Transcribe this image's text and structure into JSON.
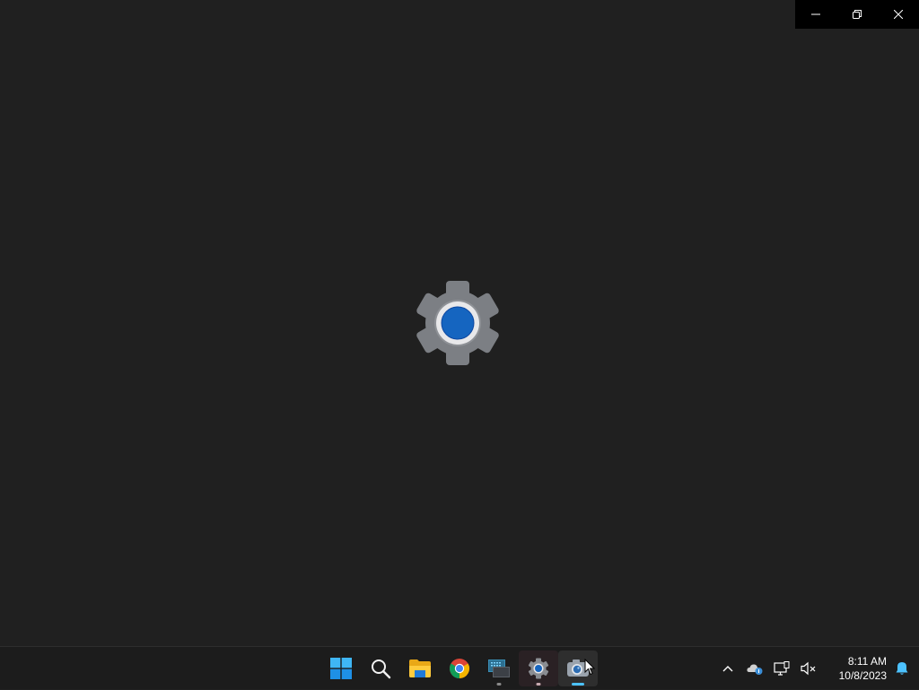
{
  "window": {
    "controls": {
      "minimize_icon": "minimize-icon",
      "restore_icon": "restore-icon",
      "close_icon": "close-icon"
    },
    "splash_icon": "settings-gear-icon"
  },
  "taskbar": {
    "apps": [
      {
        "name": "start",
        "icon": "windows-logo-icon"
      },
      {
        "name": "search",
        "icon": "search-icon"
      },
      {
        "name": "file-explorer",
        "icon": "folder-icon"
      },
      {
        "name": "chrome",
        "icon": "chrome-icon"
      },
      {
        "name": "terminal",
        "icon": "terminal-icon",
        "running": true
      },
      {
        "name": "settings",
        "icon": "settings-gear-icon",
        "running": true
      },
      {
        "name": "camera",
        "icon": "camera-icon",
        "running": true,
        "active": true
      }
    ],
    "tray": {
      "icons": [
        "chevron-up-icon",
        "onedrive-icon",
        "network-icon",
        "volume-muted-icon"
      ],
      "time": "8:11 AM",
      "date": "10/8/2023",
      "notification_icon": "bell-icon"
    }
  },
  "colors": {
    "background": "#202020",
    "taskbar": "#1c1c1c",
    "accent": "#4cc2ff",
    "gear_blue": "#1565c0"
  }
}
